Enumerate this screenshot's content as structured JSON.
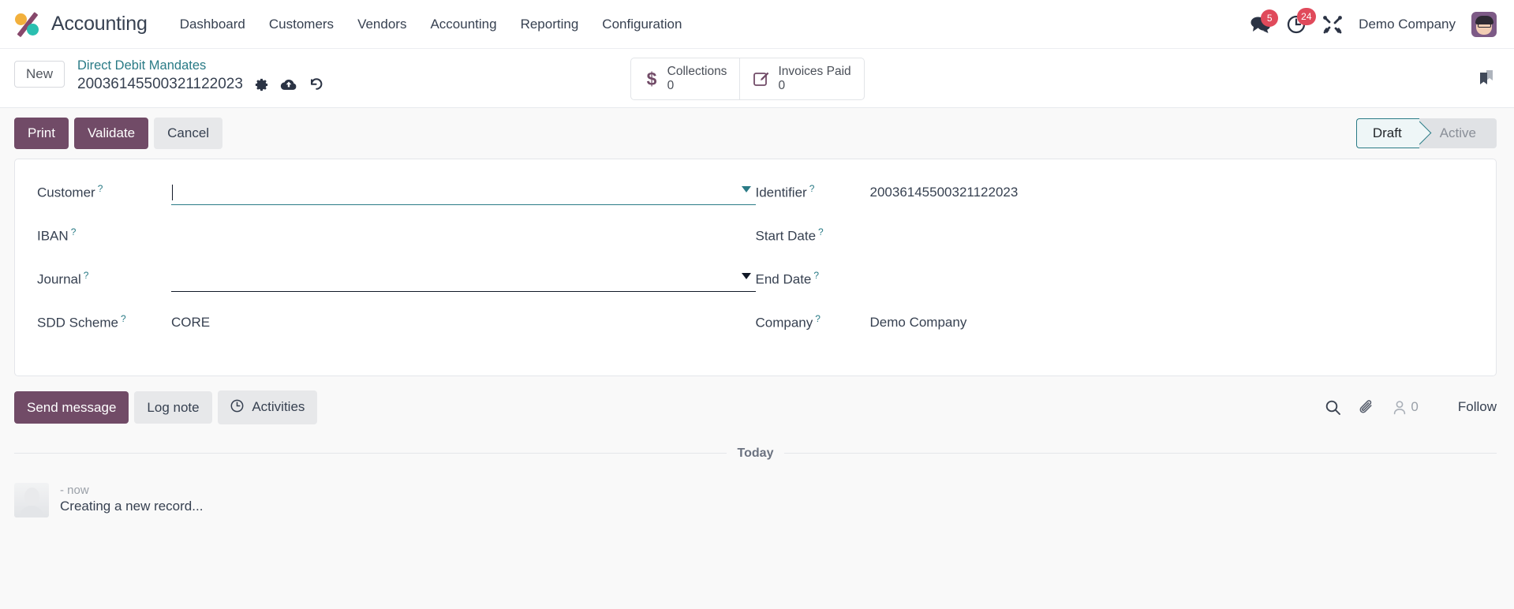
{
  "navbar": {
    "brand": "Accounting",
    "logo_icon": "odoo-logo",
    "menu": [
      {
        "label": "Dashboard"
      },
      {
        "label": "Customers"
      },
      {
        "label": "Vendors"
      },
      {
        "label": "Accounting"
      },
      {
        "label": "Reporting"
      },
      {
        "label": "Configuration"
      }
    ],
    "messages": {
      "icon": "messages-icon",
      "badge": "5"
    },
    "activities": {
      "icon": "clock-icon",
      "badge": "24"
    },
    "debug": {
      "icon": "tools-icon"
    },
    "company": "Demo Company",
    "avatar": {
      "icon": "user-avatar"
    }
  },
  "control_panel": {
    "new_button": "New",
    "breadcrumb_parent": "Direct Debit Mandates",
    "breadcrumb_current": "20036145500321122023",
    "gear_icon": "gear-icon",
    "upload_icon": "cloud-upload-icon",
    "discard_icon": "undo-icon",
    "bookmark_icon": "bookmark-icon",
    "stat_buttons": [
      {
        "icon": "dollar-icon",
        "label": "Collections",
        "value": "0"
      },
      {
        "icon": "pencil-square-icon",
        "label": "Invoices Paid",
        "value": "0"
      }
    ]
  },
  "action_bar": {
    "buttons": [
      {
        "label": "Print",
        "style": "primary"
      },
      {
        "label": "Validate",
        "style": "primary"
      },
      {
        "label": "Cancel",
        "style": "light"
      }
    ],
    "statuses": [
      {
        "label": "Draft",
        "active": true
      },
      {
        "label": "Active",
        "active": false
      }
    ]
  },
  "form": {
    "left": [
      {
        "label": "Customer",
        "value": "",
        "widget": "many2one-focused",
        "tooltip": "?"
      },
      {
        "label": "IBAN",
        "value": "",
        "widget": "text",
        "tooltip": "?"
      },
      {
        "label": "Journal",
        "value": "",
        "widget": "many2one",
        "tooltip": "?"
      },
      {
        "label": "SDD Scheme",
        "value": "CORE",
        "widget": "text",
        "tooltip": "?"
      }
    ],
    "right": [
      {
        "label": "Identifier",
        "value": "20036145500321122023",
        "widget": "text",
        "tooltip": "?"
      },
      {
        "label": "Start Date",
        "value": "",
        "widget": "date",
        "tooltip": "?"
      },
      {
        "label": "End Date",
        "value": "",
        "widget": "date",
        "tooltip": "?"
      },
      {
        "label": "Company",
        "value": "Demo Company",
        "widget": "text",
        "tooltip": "?"
      }
    ]
  },
  "chatter": {
    "send_message": "Send message",
    "log_note": "Log note",
    "activities": "Activities",
    "activities_icon": "clock-icon",
    "search_icon": "search-icon",
    "attachment_icon": "paperclip-icon",
    "followers_icon": "person-icon",
    "followers_count": "0",
    "follow_label": "Follow"
  },
  "thread": {
    "day_label": "Today",
    "message": {
      "author_meta": "- now",
      "text": "Creating a new record...",
      "avatar_icon": "default-avatar-icon"
    }
  },
  "colors": {
    "brand_purple": "#714b67",
    "accent_teal": "#2a7b86",
    "badge_red": "#e04a5b"
  }
}
